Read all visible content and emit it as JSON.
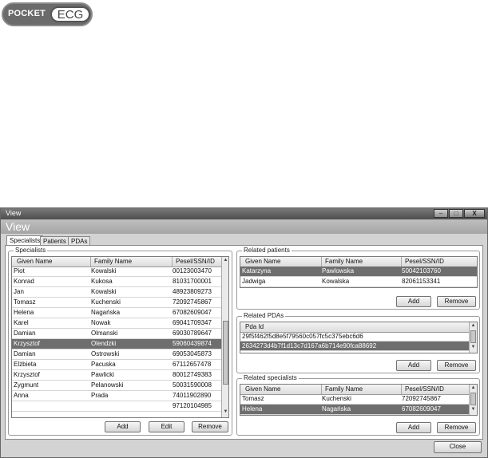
{
  "logo": {
    "left_text": "POCKET",
    "right_text": "ECG"
  },
  "window": {
    "title": "View",
    "header": "View",
    "controls": {
      "minimize": "–",
      "maximize": "□",
      "close": "X"
    }
  },
  "tabs": [
    "Specialists",
    "Patients",
    "PDAs"
  ],
  "specialists": {
    "label": "Specialists",
    "columns": [
      "Given Name",
      "Family Name",
      "Pesel/SSN/ID"
    ],
    "rows": [
      [
        "Piot",
        "Kowalski",
        "00123003470"
      ],
      [
        "Konrad",
        "Kukosa",
        "81031700001"
      ],
      [
        "Jan",
        "Kowalski",
        "48923809273"
      ],
      [
        "Tomasz",
        "Kuchenski",
        "72092745867"
      ],
      [
        "Helena",
        "Nagańska",
        "67082609047"
      ],
      [
        "Karel",
        "Nowak",
        "69041709347"
      ],
      [
        "Damian",
        "Olmanski",
        "69030789647"
      ],
      [
        "Krzysztof",
        "Olendzki",
        "59060439874"
      ],
      [
        "Damian",
        "Ostrowski",
        "69053045873"
      ],
      [
        "Elżbieta",
        "Pacuska",
        "67112657478"
      ],
      [
        "Krzysztof",
        "Pawlicki",
        "80012749383"
      ],
      [
        "Zygmunt",
        "Pelanowski",
        "50031590008"
      ],
      [
        "Anna",
        "Prada",
        "74011902890"
      ],
      [
        "",
        "",
        "97120104985"
      ]
    ],
    "selected_index": 7,
    "buttons": {
      "add": "Add",
      "edit": "Edit",
      "remove": "Remove"
    }
  },
  "related_patients": {
    "label": "Related patients",
    "columns": [
      "Given Name",
      "Family Name",
      "Pesel/SSN/ID"
    ],
    "rows": [
      [
        "Katarzyna",
        "Pawlowska",
        "50042103760"
      ],
      [
        "Jadwiga",
        "Kowalska",
        "82061153341"
      ]
    ],
    "selected_index": 0,
    "buttons": {
      "add": "Add",
      "remove": "Remove"
    }
  },
  "related_pdas": {
    "label": "Related PDAs",
    "columns": [
      "Pda Id"
    ],
    "rows": [
      [
        "29f5f462f5d8e5f79560c057fc5c375ebc6d6"
      ],
      [
        "2634273d4b7f1d13c7d167a6b714e90fca88692"
      ]
    ],
    "selected_index": 1,
    "buttons": {
      "add": "Add",
      "remove": "Remove"
    }
  },
  "related_specialists": {
    "label": "Related specialists",
    "columns": [
      "Given Name",
      "Family Name",
      "Pesel/SSN/ID"
    ],
    "rows": [
      [
        "Tomasz",
        "Kuchenski",
        "72092745867"
      ],
      [
        "Helena",
        "Nagańska",
        "67082609047"
      ]
    ],
    "selected_index": 1,
    "buttons": {
      "add": "Add",
      "remove": "Remove"
    }
  },
  "close_button": "Close"
}
